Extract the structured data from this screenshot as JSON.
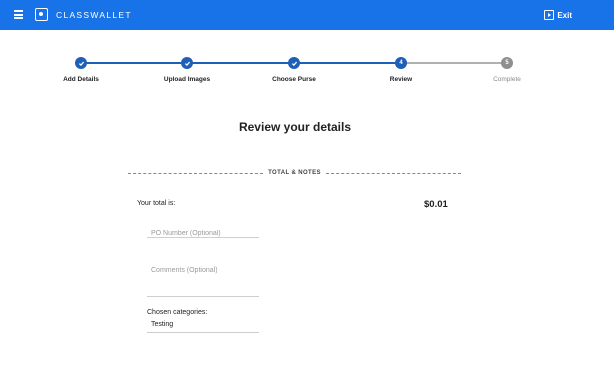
{
  "header": {
    "brand": "CLASSWALLET",
    "exit_label": "Exit",
    "color": "#1973e8"
  },
  "stepper": {
    "steps": [
      {
        "label": "Add Details",
        "state": "done",
        "marker": "check"
      },
      {
        "label": "Upload Images",
        "state": "done",
        "marker": "check"
      },
      {
        "label": "Choose Purse",
        "state": "done",
        "marker": "check"
      },
      {
        "label": "Review",
        "state": "current",
        "marker": "4"
      },
      {
        "label": "Complete",
        "state": "pending",
        "marker": "5"
      }
    ],
    "active_color": "#1e5fb8",
    "pending_color": "#8f8f8f"
  },
  "main": {
    "title": "Review your details",
    "section_label": "TOTAL & NOTES",
    "total_label": "Your total is:",
    "total_value": "$0.01",
    "po_number": {
      "placeholder": "PO Number (Optional)",
      "value": ""
    },
    "comments": {
      "placeholder": "Comments (Optional)",
      "value": ""
    },
    "categories_label": "Chosen categories:",
    "categories_value": "Testing"
  }
}
